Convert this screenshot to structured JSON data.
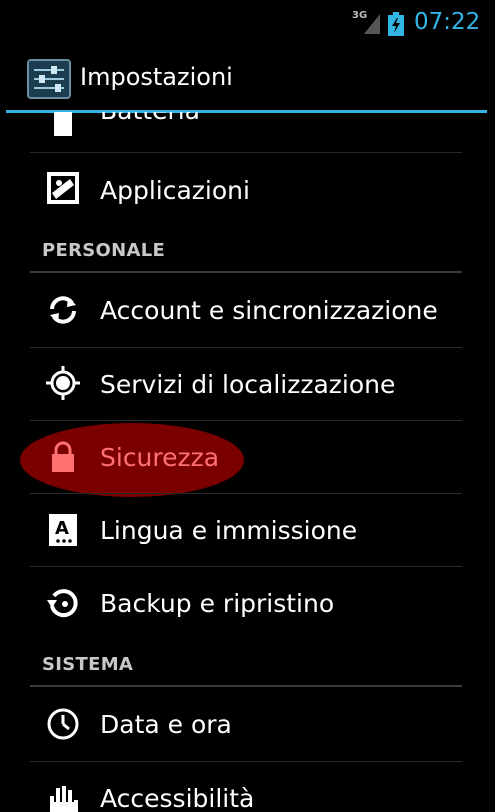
{
  "status_bar": {
    "network": "3G",
    "time": "07:22"
  },
  "action_bar": {
    "title": "Impostazioni",
    "icon": "settings-sliders-icon"
  },
  "list": {
    "items": [
      {
        "label": "Batteria",
        "icon": "battery-icon"
      },
      {
        "label": "Applicazioni",
        "icon": "applications-icon"
      },
      {
        "section": "PERSONALE"
      },
      {
        "label": "Account e sincronizzazione",
        "icon": "sync-icon"
      },
      {
        "label": "Servizi di localizzazione",
        "icon": "location-icon"
      },
      {
        "label": "Sicurezza",
        "icon": "lock-icon",
        "highlighted": true
      },
      {
        "label": "Lingua e immissione",
        "icon": "language-icon"
      },
      {
        "label": "Backup e ripristino",
        "icon": "backup-icon"
      },
      {
        "section": "SISTEMA"
      },
      {
        "label": "Data e ora",
        "icon": "clock-icon"
      },
      {
        "label": "Accessibilità",
        "icon": "accessibility-icon"
      }
    ]
  },
  "colors": {
    "accent": "#33b5e5",
    "highlight": "#7a0000",
    "highlight_text": "#ff7070"
  }
}
